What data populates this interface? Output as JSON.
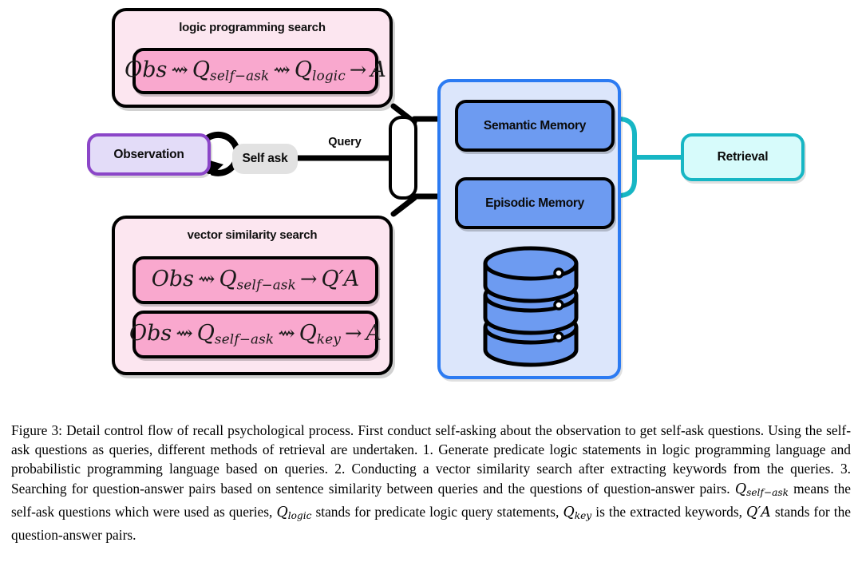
{
  "figure": {
    "logic_panel": {
      "title": "logic programming search",
      "formulas": [
        {
          "id": "logic-formula",
          "tokens": [
            "Obs",
            "⇝",
            "Q",
            "self−ask",
            "⇝",
            "Q",
            "logic",
            "→",
            "A"
          ],
          "plain": "Obs ⇝ Q_self-ask ⇝ Q_logic → A"
        }
      ]
    },
    "vector_panel": {
      "title": "vector similarity search",
      "formulas": [
        {
          "id": "vector-formula-1",
          "plain": "Obs ⇝ Q_self-ask → Q'A"
        },
        {
          "id": "vector-formula-2",
          "plain": "Obs ⇝ Q_self-ask ⇝ Q_key → A"
        }
      ]
    },
    "observation_label": "Observation",
    "self_ask_label": "Self ask",
    "query_label": "Query",
    "semantic_memory_label": "Semantic Memory",
    "episodic_memory_label": "Episodic Memory",
    "retrieval_label": "Retrieval",
    "database_icon": "database-cylinder-icon",
    "self_loop_icon": "self-loop-arrow-icon",
    "colors": {
      "pink_panel_fill": "#FCE6F0",
      "pink_formula_fill": "#F9A8CE",
      "observation_fill": "#E3DCF8",
      "observation_border": "#8B46C8",
      "self_ask_fill": "#E2E2E2",
      "memory_container_fill": "#DCE6FB",
      "memory_container_border": "#2C7BF2",
      "memory_box_fill": "#6D9BF1",
      "retrieval_fill": "#D7FBFB",
      "retrieval_border": "#17B6C4",
      "connector_black": "#000000",
      "connector_cyan": "#17B6C4",
      "database_fill": "#6D9BF1"
    }
  },
  "caption": {
    "label": "Figure 3:",
    "p1": " Detail control flow of recall psychological process. First conduct self-asking about the observation to get self-ask questions. Using the self-ask questions as queries, different methods of retrieval are undertaken. 1. Generate predicate logic statements in logic programming language and probabilistic programming language based on queries. 2. Conducting a vector similarity search after extracting keywords from the queries. 3. Searching for question-answer pairs based on sentence similarity between queries and the questions of question-answer pairs. ",
    "m1": "Q",
    "m1sub": "self−ask",
    "p2": " means the self-ask questions which were used as queries, ",
    "m2": "Q",
    "m2sub": "logic",
    "p3": " stands for predicate logic query statements, ",
    "m3": "Q",
    "m3sub": "key",
    "p4": " is the extracted keywords, ",
    "m4": "Q′A",
    "p5": " stands for the question-answer pairs."
  }
}
